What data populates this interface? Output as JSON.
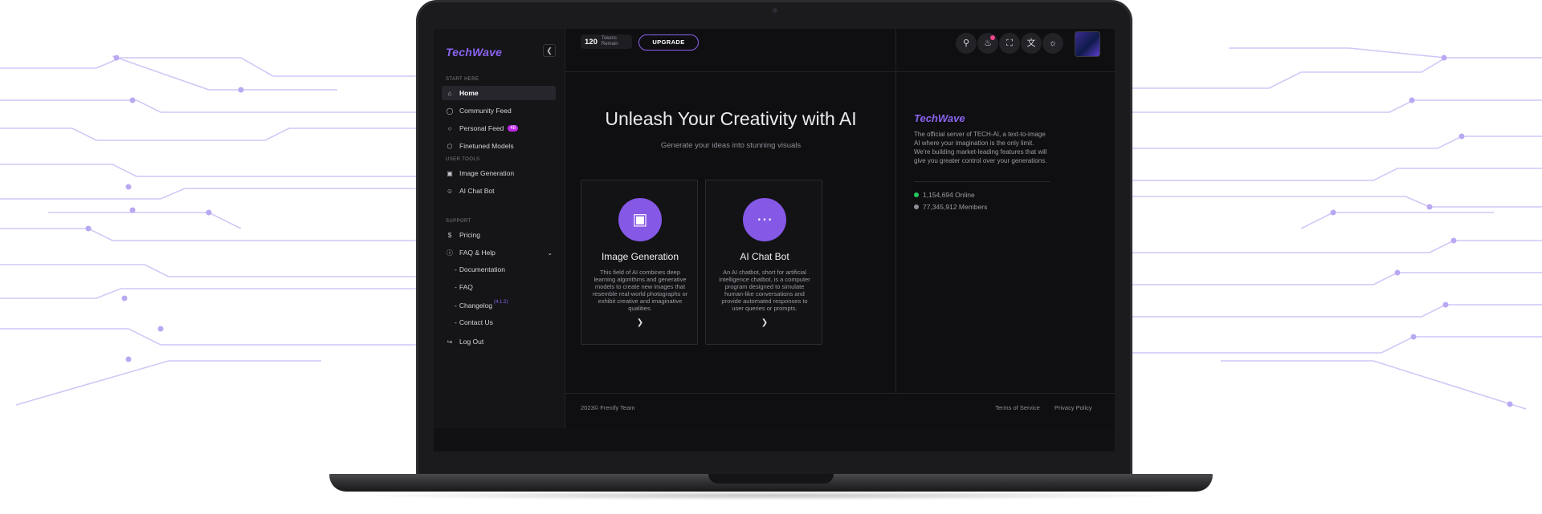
{
  "brand": {
    "name": "TechWave",
    "accent": "#8b63f0"
  },
  "sidebar": {
    "sections": [
      {
        "label": "START HERE"
      },
      {
        "label": "USER TOOLS"
      },
      {
        "label": "SUPPORT"
      }
    ],
    "items": [
      {
        "label": "Home",
        "icon": "home-icon",
        "active": true
      },
      {
        "label": "Community Feed",
        "icon": "users-icon"
      },
      {
        "label": "Personal Feed",
        "icon": "user-icon",
        "badge": "48"
      },
      {
        "label": "Finetuned Models",
        "icon": "cube-icon"
      },
      {
        "label": "Image Generation",
        "icon": "image-icon"
      },
      {
        "label": "AI Chat Bot",
        "icon": "chat-icon"
      },
      {
        "label": "Pricing",
        "icon": "dollar-icon"
      },
      {
        "label": "FAQ & Help",
        "icon": "help-icon",
        "expanded": true
      },
      {
        "label": "Log Out",
        "icon": "logout-icon"
      }
    ],
    "sub_items": [
      {
        "label": "Documentation"
      },
      {
        "label": "FAQ"
      },
      {
        "label": "Changelog",
        "version": "4.1.2"
      },
      {
        "label": "Contact Us"
      }
    ]
  },
  "topbar": {
    "tokens_count": "120",
    "tokens_label_1": "Tokens",
    "tokens_label_2": "Remain",
    "upgrade_label": "UPGRADE",
    "icons": [
      "search-icon",
      "bell-icon",
      "fullscreen-icon",
      "translate-icon",
      "sun-icon"
    ]
  },
  "main": {
    "title": "Unleash Your Creativity with AI",
    "subtitle": "Generate your ideas into stunning visuals",
    "cards": [
      {
        "title": "Image Generation",
        "description": "This field of AI combines deep learning algorithms and generative models to create new images that resemble real-world photographs or exhibit creative and imaginative qualities.",
        "icon": "image-icon"
      },
      {
        "title": "AI Chat Bot",
        "description": "An AI chatbot, short for artificial intelligence chatbot, is a computer program designed to simulate human-like conversations and provide automated responses to user queries or prompts.",
        "icon": "chat-icon"
      }
    ]
  },
  "info": {
    "logo": "TechWave",
    "description": "The official server of TECH-AI, a text-to-image AI where your imagination is the only limit. We're building market-leading features that will give you greater control over your generations.",
    "stats": [
      {
        "label": "1,154,694 Online",
        "color": "#22c55e"
      },
      {
        "label": "77,345,912 Members",
        "color": "#8e8e98"
      }
    ]
  },
  "footer": {
    "copyright": "2023© Frenify Team",
    "links": [
      "Terms of Service",
      "Privacy Policy"
    ]
  }
}
